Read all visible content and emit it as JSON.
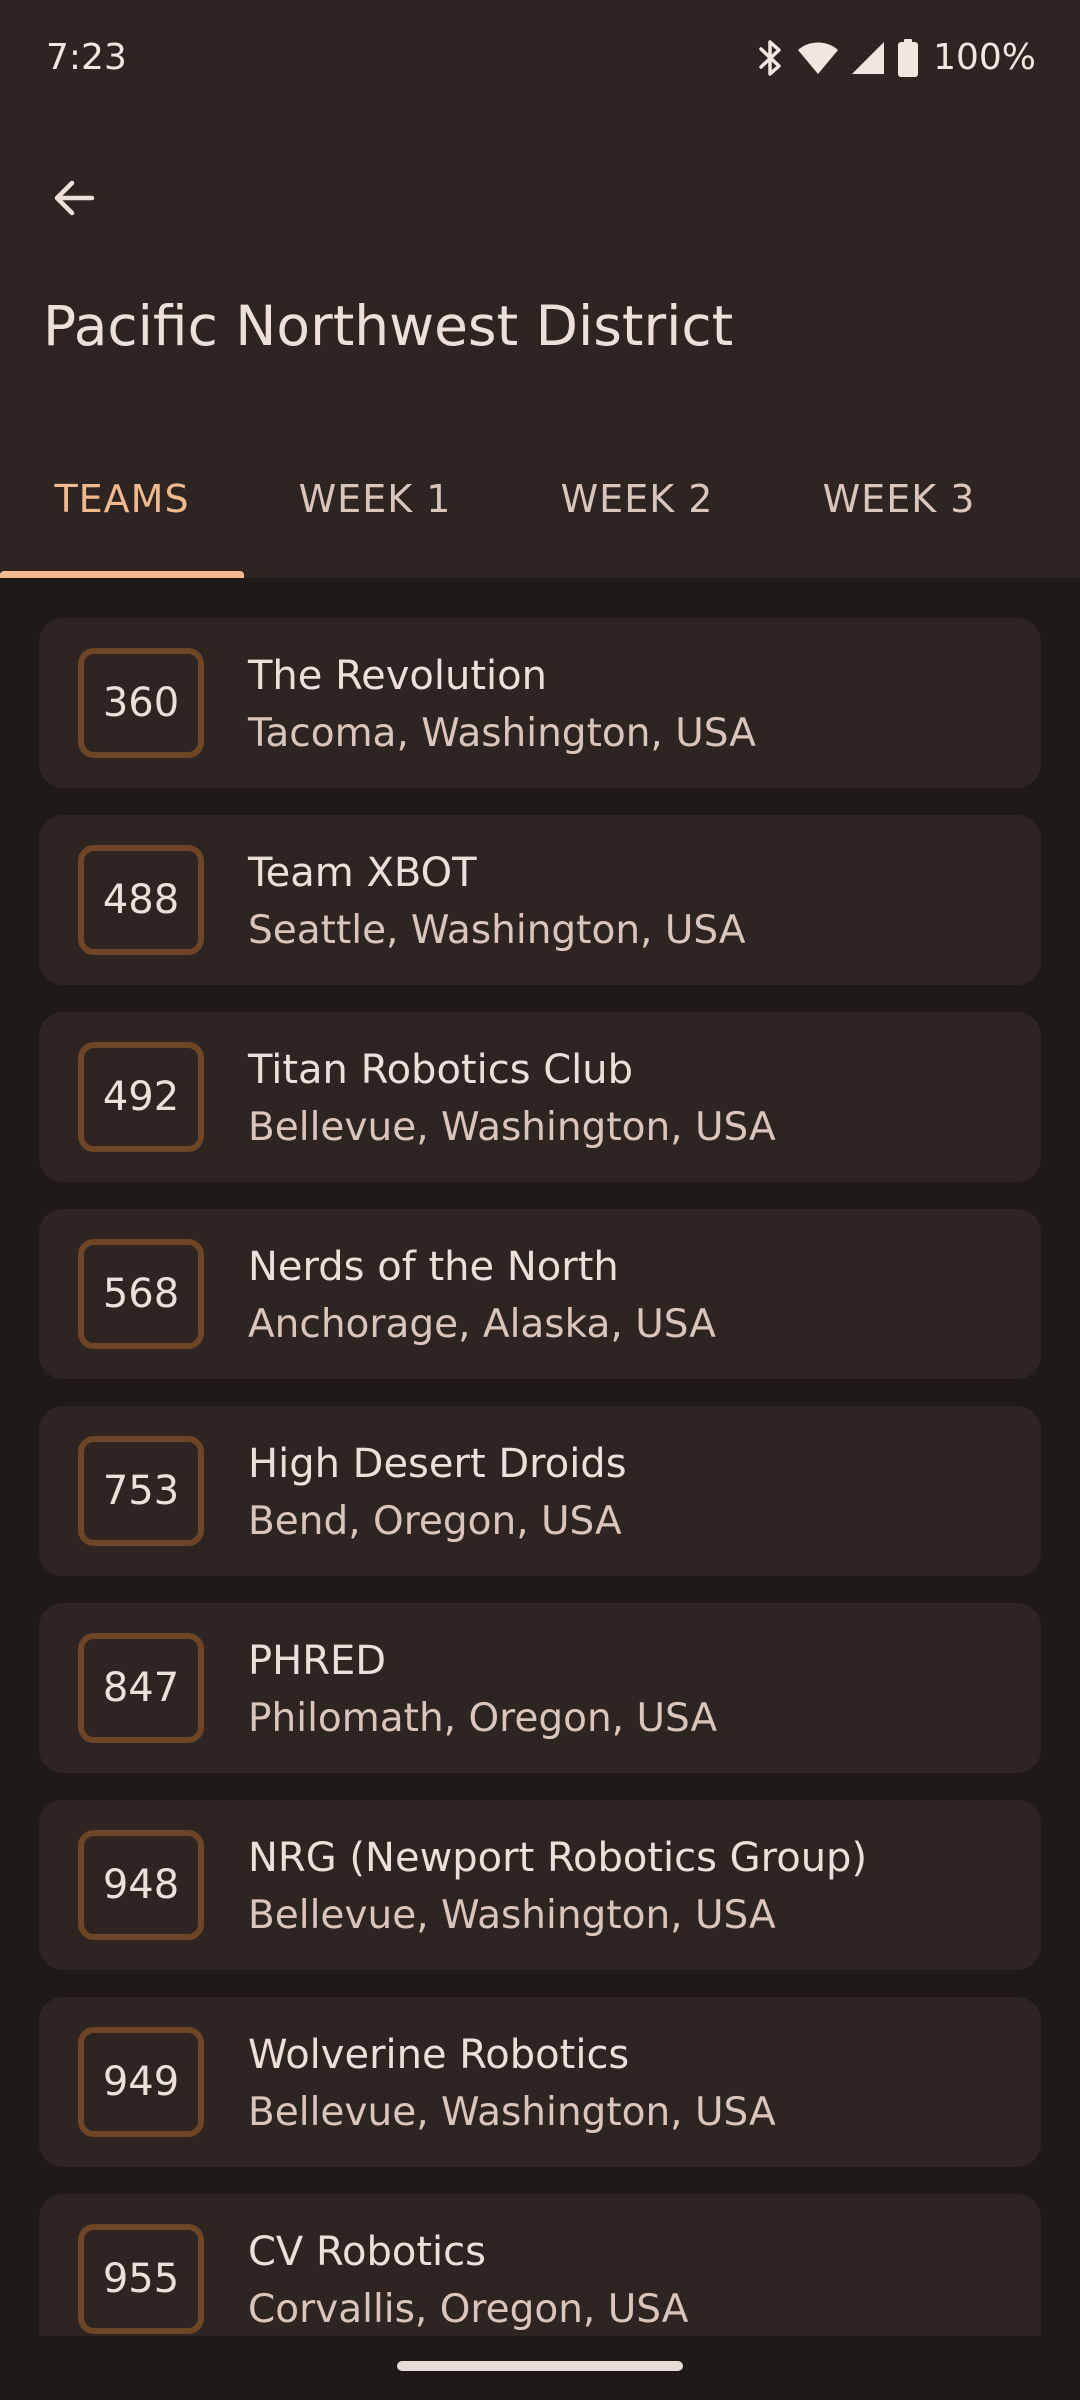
{
  "status_bar": {
    "time": "7:23",
    "battery": "100%",
    "icons": [
      "bluetooth-icon",
      "wifi-icon",
      "cellular-signal-icon",
      "battery-icon"
    ]
  },
  "header": {
    "back_icon": "arrow-back-icon",
    "title": "Pacific Northwest District"
  },
  "tabs": [
    {
      "label": "TEAMS",
      "active": true
    },
    {
      "label": "WEEK 1",
      "active": false
    },
    {
      "label": "WEEK 2",
      "active": false
    },
    {
      "label": "WEEK 3",
      "active": false
    }
  ],
  "teams": [
    {
      "number": "360",
      "name": "The Revolution",
      "location": "Tacoma, Washington, USA"
    },
    {
      "number": "488",
      "name": "Team XBOT",
      "location": "Seattle, Washington, USA"
    },
    {
      "number": "492",
      "name": "Titan Robotics Club",
      "location": "Bellevue, Washington, USA"
    },
    {
      "number": "568",
      "name": "Nerds of the North",
      "location": "Anchorage, Alaska, USA"
    },
    {
      "number": "753",
      "name": "High Desert Droids",
      "location": "Bend, Oregon, USA"
    },
    {
      "number": "847",
      "name": "PHRED",
      "location": "Philomath, Oregon, USA"
    },
    {
      "number": "948",
      "name": "NRG (Newport Robotics Group)",
      "location": "Bellevue, Washington, USA"
    },
    {
      "number": "949",
      "name": "Wolverine Robotics",
      "location": "Bellevue, Washington, USA"
    },
    {
      "number": "955",
      "name": "CV Robotics",
      "location": "Corvallis, Oregon, USA"
    }
  ],
  "colors": {
    "background": "#1f1a18",
    "surface": "#2e2522",
    "accent": "#f2b98e",
    "number_outline": "#6f4625",
    "text_primary": "#ede0da",
    "text_secondary": "#d9c5bb"
  }
}
